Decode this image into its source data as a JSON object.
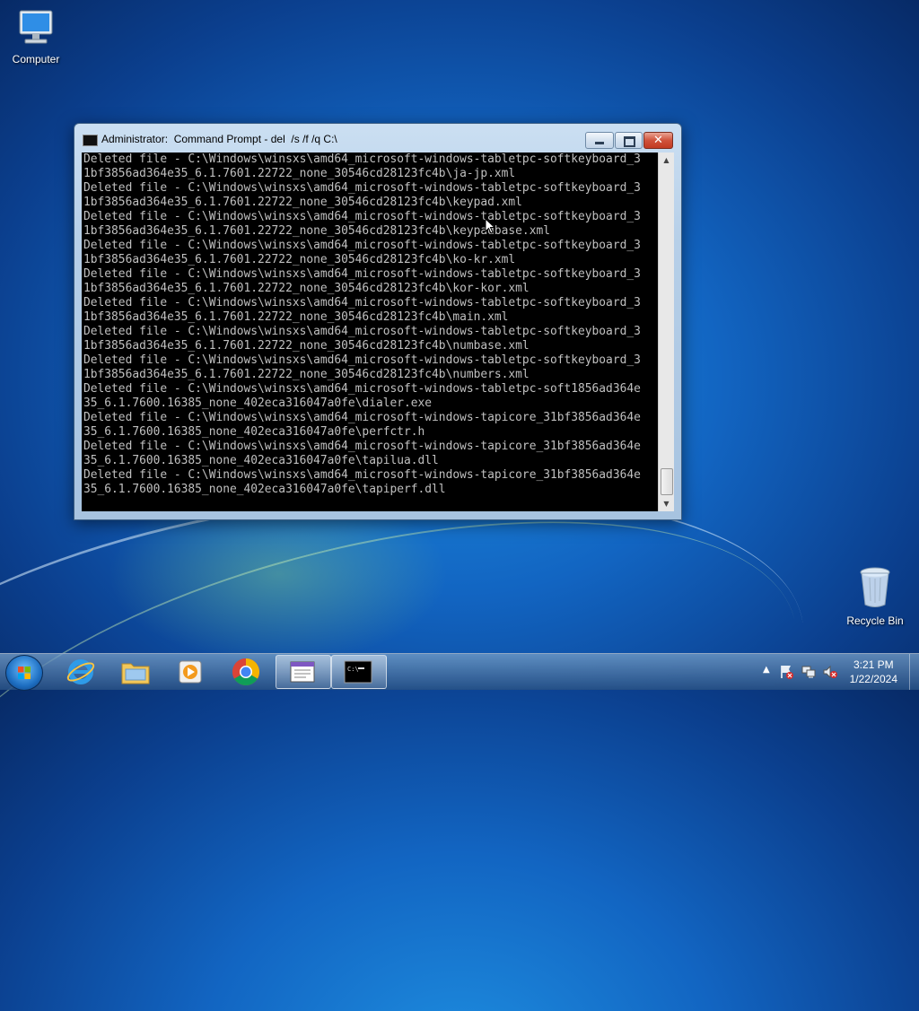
{
  "desktop": {
    "icons": [
      {
        "label": "Computer"
      },
      {
        "label": "Recycle Bin"
      }
    ]
  },
  "window": {
    "title": "Administrator:  Command Prompt - del  /s /f /q C:\\",
    "controls": {
      "close_glyph": "✕"
    },
    "console_lines": [
      "Deleted file - C:\\Windows\\winsxs\\amd64_microsoft-windows-tabletpc-softkeyboard_3",
      "1bf3856ad364e35_6.1.7601.22722_none_30546cd28123fc4b\\ja-jp.xml",
      "Deleted file - C:\\Windows\\winsxs\\amd64_microsoft-windows-tabletpc-softkeyboard_3",
      "1bf3856ad364e35_6.1.7601.22722_none_30546cd28123fc4b\\keypad.xml",
      "Deleted file - C:\\Windows\\winsxs\\amd64_microsoft-windows-tabletpc-softkeyboard_3",
      "1bf3856ad364e35_6.1.7601.22722_none_30546cd28123fc4b\\keypadbase.xml",
      "Deleted file - C:\\Windows\\winsxs\\amd64_microsoft-windows-tabletpc-softkeyboard_3",
      "1bf3856ad364e35_6.1.7601.22722_none_30546cd28123fc4b\\ko-kr.xml",
      "Deleted file - C:\\Windows\\winsxs\\amd64_microsoft-windows-tabletpc-softkeyboard_3",
      "1bf3856ad364e35_6.1.7601.22722_none_30546cd28123fc4b\\kor-kor.xml",
      "Deleted file - C:\\Windows\\winsxs\\amd64_microsoft-windows-tabletpc-softkeyboard_3",
      "1bf3856ad364e35_6.1.7601.22722_none_30546cd28123fc4b\\main.xml",
      "Deleted file - C:\\Windows\\winsxs\\amd64_microsoft-windows-tabletpc-softkeyboard_3",
      "1bf3856ad364e35_6.1.7601.22722_none_30546cd28123fc4b\\numbase.xml",
      "Deleted file - C:\\Windows\\winsxs\\amd64_microsoft-windows-tabletpc-softkeyboard_3",
      "1bf3856ad364e35_6.1.7601.22722_none_30546cd28123fc4b\\numbers.xml",
      "Deleted file - C:\\Windows\\winsxs\\amd64_microsoft-windows-tabletpc-soft1856ad364e",
      "35_6.1.7600.16385_none_402eca316047a0fe\\dialer.exe",
      "Deleted file - C:\\Windows\\winsxs\\amd64_microsoft-windows-tapicore_31bf3856ad364e",
      "35_6.1.7600.16385_none_402eca316047a0fe\\perfctr.h",
      "Deleted file - C:\\Windows\\winsxs\\amd64_microsoft-windows-tapicore_31bf3856ad364e",
      "35_6.1.7600.16385_none_402eca316047a0fe\\tapilua.dll",
      "Deleted file - C:\\Windows\\winsxs\\amd64_microsoft-windows-tapicore_31bf3856ad364e",
      "35_6.1.7600.16385_none_402eca316047a0fe\\tapiperf.dll"
    ],
    "scrollbar": {
      "position": 0.95
    }
  },
  "taskbar": {
    "pinned": [
      {
        "name": "internet-explorer",
        "icon": "ie-icon"
      },
      {
        "name": "windows-explorer",
        "icon": "folder-icon"
      },
      {
        "name": "media-player",
        "icon": "media-player-icon"
      },
      {
        "name": "chrome",
        "icon": "chrome-icon"
      },
      {
        "name": "notepad-window",
        "icon": "notepad-icon"
      },
      {
        "name": "command-prompt",
        "icon": "cmd-icon"
      }
    ],
    "clock": {
      "time": "3:21 PM",
      "date": "1/22/2024"
    }
  },
  "colors": {
    "console_bg": "#000000",
    "console_fg": "#c0c0c0",
    "close_red": "#c23a21"
  }
}
